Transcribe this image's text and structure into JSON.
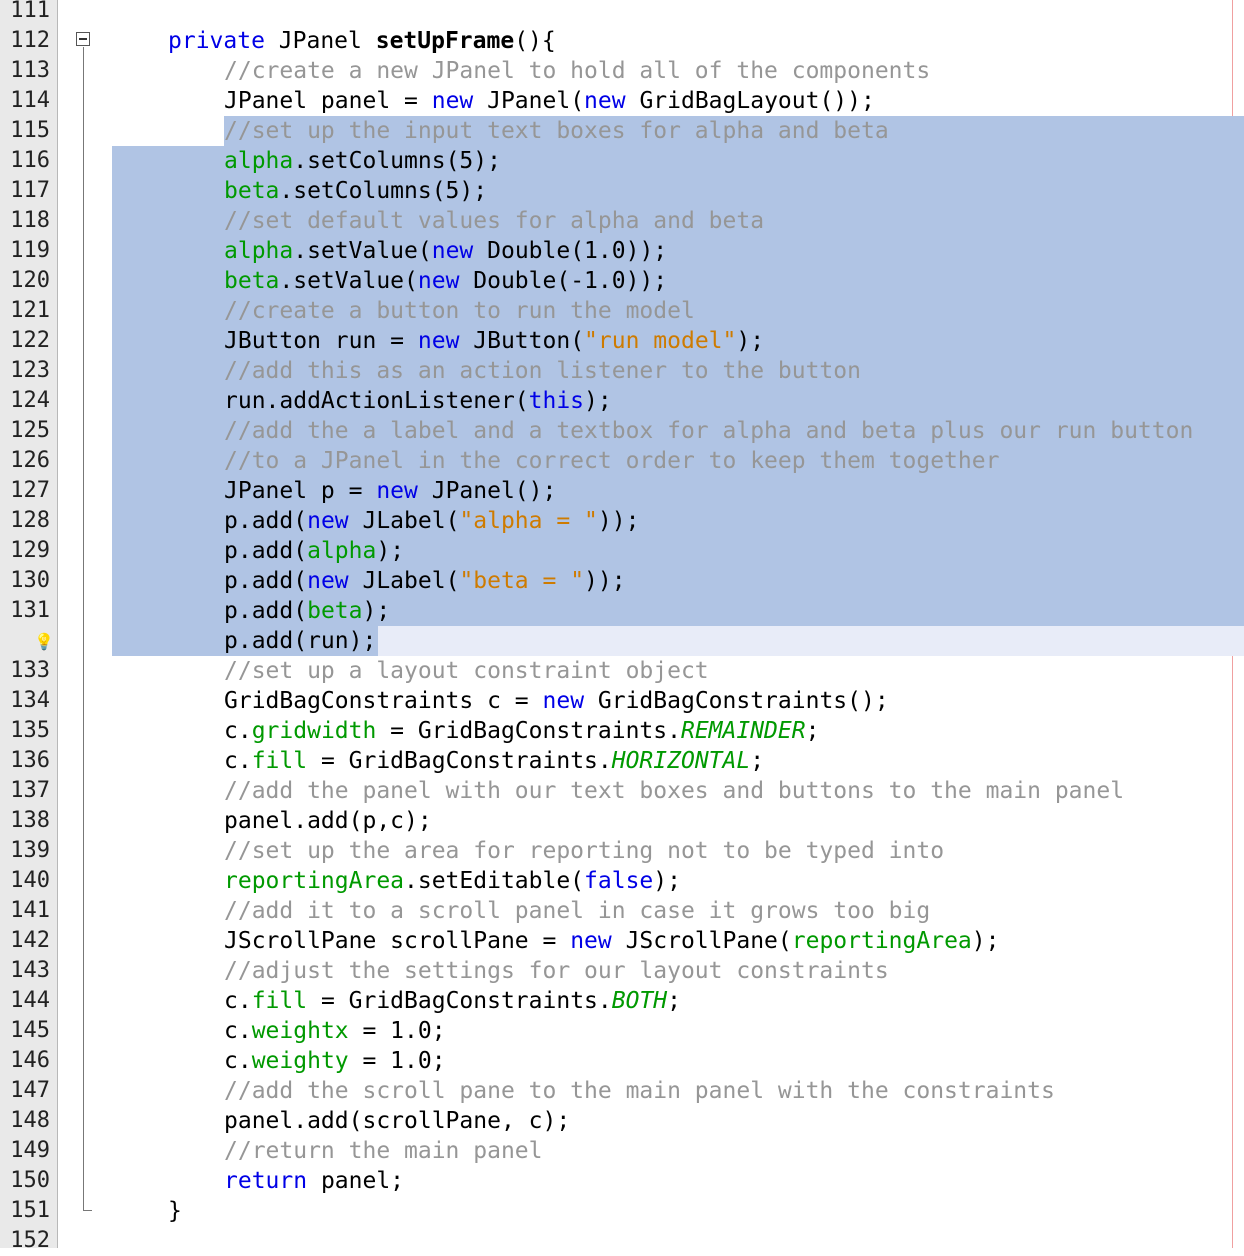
{
  "editor": {
    "language": "java",
    "lines": [
      {
        "n": "111",
        "indent": 0,
        "sel": "",
        "tokens": []
      },
      {
        "n": "112",
        "indent": 1,
        "sel": "",
        "tokens": [
          [
            "kw",
            "private"
          ],
          [
            "p",
            " JPanel "
          ],
          [
            "bold",
            "setUpFrame"
          ],
          [
            "p",
            "(){"
          ]
        ]
      },
      {
        "n": "113",
        "indent": 2,
        "sel": "",
        "tokens": [
          [
            "cm",
            "//create a new JPanel to hold all of the components"
          ]
        ]
      },
      {
        "n": "114",
        "indent": 2,
        "sel": "",
        "tokens": [
          [
            "p",
            "JPanel panel = "
          ],
          [
            "kw",
            "new"
          ],
          [
            "p",
            " JPanel("
          ],
          [
            "kw",
            "new"
          ],
          [
            "p",
            " GridBagLayout());"
          ]
        ]
      },
      {
        "n": "115",
        "indent": 2,
        "sel": "from-text",
        "tokens": [
          [
            "cm",
            "//set up the input text boxes for alpha and beta"
          ]
        ]
      },
      {
        "n": "116",
        "indent": 2,
        "sel": "full",
        "tokens": [
          [
            "fld",
            "alpha"
          ],
          [
            "p",
            ".setColumns(5);"
          ]
        ]
      },
      {
        "n": "117",
        "indent": 2,
        "sel": "full",
        "tokens": [
          [
            "fld",
            "beta"
          ],
          [
            "p",
            ".setColumns(5);"
          ]
        ]
      },
      {
        "n": "118",
        "indent": 2,
        "sel": "full",
        "tokens": [
          [
            "cm",
            "//set default values for alpha and beta"
          ]
        ]
      },
      {
        "n": "119",
        "indent": 2,
        "sel": "full",
        "tokens": [
          [
            "fld",
            "alpha"
          ],
          [
            "p",
            ".setValue("
          ],
          [
            "kw",
            "new"
          ],
          [
            "p",
            " Double(1.0));"
          ]
        ]
      },
      {
        "n": "120",
        "indent": 2,
        "sel": "full",
        "tokens": [
          [
            "fld",
            "beta"
          ],
          [
            "p",
            ".setValue("
          ],
          [
            "kw",
            "new"
          ],
          [
            "p",
            " Double(-1.0));"
          ]
        ]
      },
      {
        "n": "121",
        "indent": 2,
        "sel": "full",
        "tokens": [
          [
            "cm",
            "//create a button to run the model"
          ]
        ]
      },
      {
        "n": "122",
        "indent": 2,
        "sel": "full",
        "tokens": [
          [
            "p",
            "JButton run = "
          ],
          [
            "kw",
            "new"
          ],
          [
            "p",
            " JButton("
          ],
          [
            "str",
            "\"run model\""
          ],
          [
            "p",
            ");"
          ]
        ]
      },
      {
        "n": "123",
        "indent": 2,
        "sel": "full",
        "tokens": [
          [
            "cm",
            "//add this as an action listener to the button"
          ]
        ]
      },
      {
        "n": "124",
        "indent": 2,
        "sel": "full",
        "tokens": [
          [
            "p",
            "run.addActionListener("
          ],
          [
            "kw",
            "this"
          ],
          [
            "p",
            ");"
          ]
        ]
      },
      {
        "n": "125",
        "indent": 2,
        "sel": "full",
        "tokens": [
          [
            "cm",
            "//add the a label and a textbox for alpha and beta plus our run button"
          ]
        ]
      },
      {
        "n": "126",
        "indent": 2,
        "sel": "full",
        "tokens": [
          [
            "cm",
            "//to a JPanel in the correct order to keep them together"
          ]
        ]
      },
      {
        "n": "127",
        "indent": 2,
        "sel": "full",
        "tokens": [
          [
            "p",
            "JPanel p = "
          ],
          [
            "kw",
            "new"
          ],
          [
            "p",
            " JPanel();"
          ]
        ]
      },
      {
        "n": "128",
        "indent": 2,
        "sel": "full",
        "tokens": [
          [
            "p",
            "p.add("
          ],
          [
            "kw",
            "new"
          ],
          [
            "p",
            " JLabel("
          ],
          [
            "str",
            "\"alpha = \""
          ],
          [
            "p",
            "));"
          ]
        ]
      },
      {
        "n": "129",
        "indent": 2,
        "sel": "full",
        "tokens": [
          [
            "p",
            "p.add("
          ],
          [
            "fld",
            "alpha"
          ],
          [
            "p",
            ");"
          ]
        ]
      },
      {
        "n": "130",
        "indent": 2,
        "sel": "full",
        "tokens": [
          [
            "p",
            "p.add("
          ],
          [
            "kw",
            "new"
          ],
          [
            "p",
            " JLabel("
          ],
          [
            "str",
            "\"beta = \""
          ],
          [
            "p",
            "));"
          ]
        ]
      },
      {
        "n": "131",
        "indent": 2,
        "sel": "full",
        "tokens": [
          [
            "p",
            "p.add("
          ],
          [
            "fld",
            "beta"
          ],
          [
            "p",
            ");"
          ]
        ]
      },
      {
        "n": "",
        "indent": 2,
        "sel": "part",
        "hint": true,
        "tokens": [
          [
            "p",
            "p.add(run);"
          ]
        ]
      },
      {
        "n": "133",
        "indent": 2,
        "sel": "",
        "tokens": [
          [
            "cm",
            "//set up a layout constraint object"
          ]
        ]
      },
      {
        "n": "134",
        "indent": 2,
        "sel": "",
        "tokens": [
          [
            "p",
            "GridBagConstraints c = "
          ],
          [
            "kw",
            "new"
          ],
          [
            "p",
            " GridBagConstraints();"
          ]
        ]
      },
      {
        "n": "135",
        "indent": 2,
        "sel": "",
        "tokens": [
          [
            "p",
            "c."
          ],
          [
            "fld",
            "gridwidth"
          ],
          [
            "p",
            " = GridBagConstraints."
          ],
          [
            "cst",
            "REMAINDER"
          ],
          [
            "p",
            ";"
          ]
        ]
      },
      {
        "n": "136",
        "indent": 2,
        "sel": "",
        "tokens": [
          [
            "p",
            "c."
          ],
          [
            "fld",
            "fill"
          ],
          [
            "p",
            " = GridBagConstraints."
          ],
          [
            "cst",
            "HORIZONTAL"
          ],
          [
            "p",
            ";"
          ]
        ]
      },
      {
        "n": "137",
        "indent": 2,
        "sel": "",
        "tokens": [
          [
            "cm",
            "//add the panel with our text boxes and buttons to the main panel"
          ]
        ]
      },
      {
        "n": "138",
        "indent": 2,
        "sel": "",
        "tokens": [
          [
            "p",
            "panel.add(p,c);"
          ]
        ]
      },
      {
        "n": "139",
        "indent": 2,
        "sel": "",
        "tokens": [
          [
            "cm",
            "//set up the area for reporting not to be typed into"
          ]
        ]
      },
      {
        "n": "140",
        "indent": 2,
        "sel": "",
        "tokens": [
          [
            "fld",
            "reportingArea"
          ],
          [
            "p",
            ".setEditable("
          ],
          [
            "kw",
            "false"
          ],
          [
            "p",
            ");"
          ]
        ]
      },
      {
        "n": "141",
        "indent": 2,
        "sel": "",
        "tokens": [
          [
            "cm",
            "//add it to a scroll panel in case it grows too big"
          ]
        ]
      },
      {
        "n": "142",
        "indent": 2,
        "sel": "",
        "tokens": [
          [
            "p",
            "JScrollPane scrollPane = "
          ],
          [
            "kw",
            "new"
          ],
          [
            "p",
            " JScrollPane("
          ],
          [
            "fld",
            "reportingArea"
          ],
          [
            "p",
            ");"
          ]
        ]
      },
      {
        "n": "143",
        "indent": 2,
        "sel": "",
        "tokens": [
          [
            "cm",
            "//adjust the settings for our layout constraints"
          ]
        ]
      },
      {
        "n": "144",
        "indent": 2,
        "sel": "",
        "tokens": [
          [
            "p",
            "c."
          ],
          [
            "fld",
            "fill"
          ],
          [
            "p",
            " = GridBagConstraints."
          ],
          [
            "cst",
            "BOTH"
          ],
          [
            "p",
            ";"
          ]
        ]
      },
      {
        "n": "145",
        "indent": 2,
        "sel": "",
        "tokens": [
          [
            "p",
            "c."
          ],
          [
            "fld",
            "weightx"
          ],
          [
            "p",
            " = 1.0;"
          ]
        ]
      },
      {
        "n": "146",
        "indent": 2,
        "sel": "",
        "tokens": [
          [
            "p",
            "c."
          ],
          [
            "fld",
            "weighty"
          ],
          [
            "p",
            " = 1.0;"
          ]
        ]
      },
      {
        "n": "147",
        "indent": 2,
        "sel": "",
        "tokens": [
          [
            "cm",
            "//add the scroll pane to the main panel with the constraints"
          ]
        ]
      },
      {
        "n": "148",
        "indent": 2,
        "sel": "",
        "tokens": [
          [
            "p",
            "panel.add(scrollPane, c);"
          ]
        ]
      },
      {
        "n": "149",
        "indent": 2,
        "sel": "",
        "tokens": [
          [
            "cm",
            "//return the main panel"
          ]
        ]
      },
      {
        "n": "150",
        "indent": 2,
        "sel": "",
        "tokens": [
          [
            "kw",
            "return"
          ],
          [
            "p",
            " panel;"
          ]
        ]
      },
      {
        "n": "151",
        "indent": 1,
        "sel": "",
        "tokens": [
          [
            "p",
            "}"
          ]
        ]
      },
      {
        "n": "152",
        "indent": 0,
        "sel": "",
        "tokens": []
      }
    ]
  },
  "colors": {
    "keyword": "#0000e6",
    "comment": "#969696",
    "field": "#009900",
    "string": "#ce7b00",
    "selection": "#b0c4e4"
  },
  "icons": {
    "fold": "fold-collapse-icon",
    "hint": "lightbulb-hint-icon"
  }
}
